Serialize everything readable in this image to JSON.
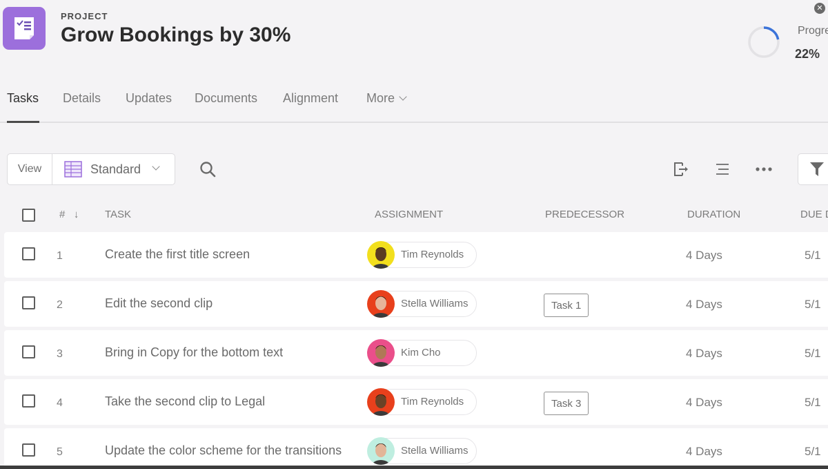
{
  "header": {
    "eyebrow": "PROJECT",
    "title": "Grow Bookings by 30%",
    "progress_label": "Progress",
    "progress_value": "22%",
    "progress_fraction": 0.22,
    "close_glyph": "✕",
    "accent_color": "#9c6fdc",
    "progress_color": "#3b73d9"
  },
  "tabs": [
    {
      "label": "Tasks",
      "active": true
    },
    {
      "label": "Details"
    },
    {
      "label": "Updates"
    },
    {
      "label": "Documents"
    },
    {
      "label": "Alignment"
    },
    {
      "label": "More"
    }
  ],
  "toolbar": {
    "view_label": "View",
    "view_value": "Standard",
    "icons": [
      "search-icon",
      "export-icon",
      "list-icon",
      "more-icon",
      "filter-icon"
    ]
  },
  "columns": {
    "number": "#",
    "sort_glyph": "↓",
    "task": "TASK",
    "assignment": "ASSIGNMENT",
    "predecessor": "PREDECESSOR",
    "duration": "DURATION",
    "due": "DUE D"
  },
  "rows": [
    {
      "num": "1",
      "task": "Create the first title screen",
      "assignee": "Tim Reynolds",
      "avatar_bg": "#f2df1d",
      "skin": "#5a3a22",
      "predecessor": "",
      "duration": "4 Days",
      "due": "5/1"
    },
    {
      "num": "2",
      "task": "Edit the second clip",
      "assignee": "Stella Williams",
      "avatar_bg": "#e8401c",
      "skin": "#e7b59a",
      "predecessor": "Task 1",
      "duration": "4 Days",
      "due": "5/1"
    },
    {
      "num": "3",
      "task": "Bring in Copy for the bottom text",
      "assignee": "Kim Cho",
      "avatar_bg": "#ea4f8a",
      "skin": "#b07856",
      "predecessor": "",
      "duration": "4 Days",
      "due": "5/1"
    },
    {
      "num": "4",
      "task": "Take the second clip to Legal",
      "assignee": "Tim Reynolds",
      "avatar_bg": "#e8401c",
      "skin": "#6b4226",
      "predecessor": "Task 3",
      "duration": "4 Days",
      "due": "5/1"
    },
    {
      "num": "5",
      "task": "Update the color scheme for the transitions",
      "assignee": "Stella Williams",
      "avatar_bg": "#bfeee0",
      "skin": "#e2b598",
      "predecessor": "",
      "duration": "4 Days",
      "due": "5/1"
    }
  ]
}
